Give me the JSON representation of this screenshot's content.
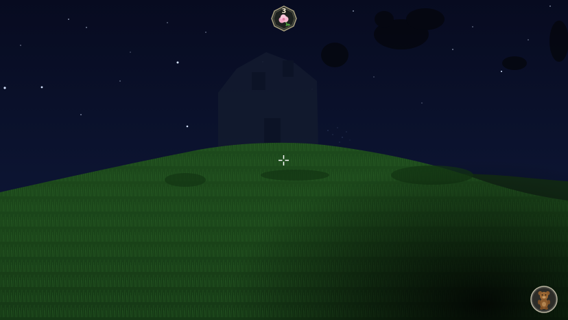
{
  "hud": {
    "collectible_count": "3",
    "collectible_icon": "pink-flower-icon",
    "companion_icon": "teddy-bear-icon"
  },
  "scene": {
    "sky_color": "#0b112c",
    "grass_color": "#1f4f1d",
    "crosshair_color": "#ffffff"
  }
}
